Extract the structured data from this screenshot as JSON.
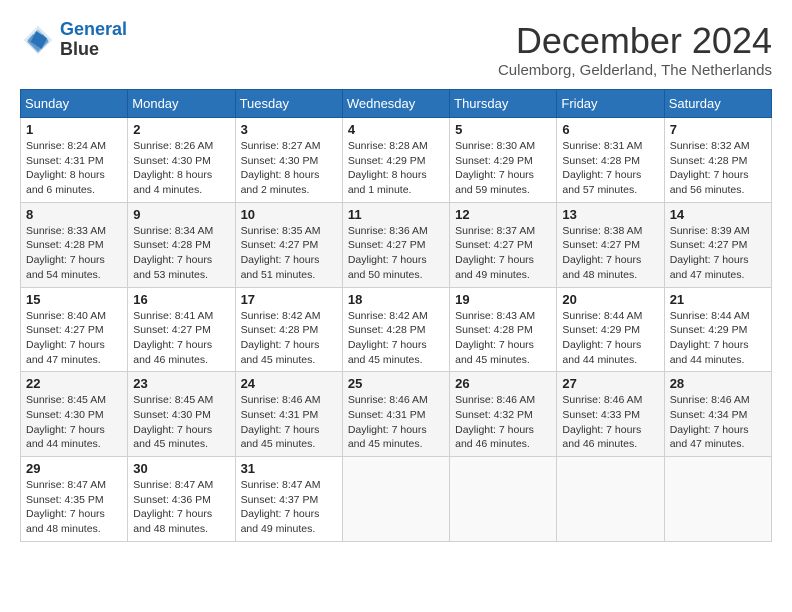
{
  "header": {
    "logo_line1": "General",
    "logo_line2": "Blue",
    "month_title": "December 2024",
    "subtitle": "Culemborg, Gelderland, The Netherlands"
  },
  "days_of_week": [
    "Sunday",
    "Monday",
    "Tuesday",
    "Wednesday",
    "Thursday",
    "Friday",
    "Saturday"
  ],
  "weeks": [
    [
      {
        "day": "1",
        "sunrise": "Sunrise: 8:24 AM",
        "sunset": "Sunset: 4:31 PM",
        "daylight": "Daylight: 8 hours and 6 minutes."
      },
      {
        "day": "2",
        "sunrise": "Sunrise: 8:26 AM",
        "sunset": "Sunset: 4:30 PM",
        "daylight": "Daylight: 8 hours and 4 minutes."
      },
      {
        "day": "3",
        "sunrise": "Sunrise: 8:27 AM",
        "sunset": "Sunset: 4:30 PM",
        "daylight": "Daylight: 8 hours and 2 minutes."
      },
      {
        "day": "4",
        "sunrise": "Sunrise: 8:28 AM",
        "sunset": "Sunset: 4:29 PM",
        "daylight": "Daylight: 8 hours and 1 minute."
      },
      {
        "day": "5",
        "sunrise": "Sunrise: 8:30 AM",
        "sunset": "Sunset: 4:29 PM",
        "daylight": "Daylight: 7 hours and 59 minutes."
      },
      {
        "day": "6",
        "sunrise": "Sunrise: 8:31 AM",
        "sunset": "Sunset: 4:28 PM",
        "daylight": "Daylight: 7 hours and 57 minutes."
      },
      {
        "day": "7",
        "sunrise": "Sunrise: 8:32 AM",
        "sunset": "Sunset: 4:28 PM",
        "daylight": "Daylight: 7 hours and 56 minutes."
      }
    ],
    [
      {
        "day": "8",
        "sunrise": "Sunrise: 8:33 AM",
        "sunset": "Sunset: 4:28 PM",
        "daylight": "Daylight: 7 hours and 54 minutes."
      },
      {
        "day": "9",
        "sunrise": "Sunrise: 8:34 AM",
        "sunset": "Sunset: 4:28 PM",
        "daylight": "Daylight: 7 hours and 53 minutes."
      },
      {
        "day": "10",
        "sunrise": "Sunrise: 8:35 AM",
        "sunset": "Sunset: 4:27 PM",
        "daylight": "Daylight: 7 hours and 51 minutes."
      },
      {
        "day": "11",
        "sunrise": "Sunrise: 8:36 AM",
        "sunset": "Sunset: 4:27 PM",
        "daylight": "Daylight: 7 hours and 50 minutes."
      },
      {
        "day": "12",
        "sunrise": "Sunrise: 8:37 AM",
        "sunset": "Sunset: 4:27 PM",
        "daylight": "Daylight: 7 hours and 49 minutes."
      },
      {
        "day": "13",
        "sunrise": "Sunrise: 8:38 AM",
        "sunset": "Sunset: 4:27 PM",
        "daylight": "Daylight: 7 hours and 48 minutes."
      },
      {
        "day": "14",
        "sunrise": "Sunrise: 8:39 AM",
        "sunset": "Sunset: 4:27 PM",
        "daylight": "Daylight: 7 hours and 47 minutes."
      }
    ],
    [
      {
        "day": "15",
        "sunrise": "Sunrise: 8:40 AM",
        "sunset": "Sunset: 4:27 PM",
        "daylight": "Daylight: 7 hours and 47 minutes."
      },
      {
        "day": "16",
        "sunrise": "Sunrise: 8:41 AM",
        "sunset": "Sunset: 4:27 PM",
        "daylight": "Daylight: 7 hours and 46 minutes."
      },
      {
        "day": "17",
        "sunrise": "Sunrise: 8:42 AM",
        "sunset": "Sunset: 4:28 PM",
        "daylight": "Daylight: 7 hours and 45 minutes."
      },
      {
        "day": "18",
        "sunrise": "Sunrise: 8:42 AM",
        "sunset": "Sunset: 4:28 PM",
        "daylight": "Daylight: 7 hours and 45 minutes."
      },
      {
        "day": "19",
        "sunrise": "Sunrise: 8:43 AM",
        "sunset": "Sunset: 4:28 PM",
        "daylight": "Daylight: 7 hours and 45 minutes."
      },
      {
        "day": "20",
        "sunrise": "Sunrise: 8:44 AM",
        "sunset": "Sunset: 4:29 PM",
        "daylight": "Daylight: 7 hours and 44 minutes."
      },
      {
        "day": "21",
        "sunrise": "Sunrise: 8:44 AM",
        "sunset": "Sunset: 4:29 PM",
        "daylight": "Daylight: 7 hours and 44 minutes."
      }
    ],
    [
      {
        "day": "22",
        "sunrise": "Sunrise: 8:45 AM",
        "sunset": "Sunset: 4:30 PM",
        "daylight": "Daylight: 7 hours and 44 minutes."
      },
      {
        "day": "23",
        "sunrise": "Sunrise: 8:45 AM",
        "sunset": "Sunset: 4:30 PM",
        "daylight": "Daylight: 7 hours and 45 minutes."
      },
      {
        "day": "24",
        "sunrise": "Sunrise: 8:46 AM",
        "sunset": "Sunset: 4:31 PM",
        "daylight": "Daylight: 7 hours and 45 minutes."
      },
      {
        "day": "25",
        "sunrise": "Sunrise: 8:46 AM",
        "sunset": "Sunset: 4:31 PM",
        "daylight": "Daylight: 7 hours and 45 minutes."
      },
      {
        "day": "26",
        "sunrise": "Sunrise: 8:46 AM",
        "sunset": "Sunset: 4:32 PM",
        "daylight": "Daylight: 7 hours and 46 minutes."
      },
      {
        "day": "27",
        "sunrise": "Sunrise: 8:46 AM",
        "sunset": "Sunset: 4:33 PM",
        "daylight": "Daylight: 7 hours and 46 minutes."
      },
      {
        "day": "28",
        "sunrise": "Sunrise: 8:46 AM",
        "sunset": "Sunset: 4:34 PM",
        "daylight": "Daylight: 7 hours and 47 minutes."
      }
    ],
    [
      {
        "day": "29",
        "sunrise": "Sunrise: 8:47 AM",
        "sunset": "Sunset: 4:35 PM",
        "daylight": "Daylight: 7 hours and 48 minutes."
      },
      {
        "day": "30",
        "sunrise": "Sunrise: 8:47 AM",
        "sunset": "Sunset: 4:36 PM",
        "daylight": "Daylight: 7 hours and 48 minutes."
      },
      {
        "day": "31",
        "sunrise": "Sunrise: 8:47 AM",
        "sunset": "Sunset: 4:37 PM",
        "daylight": "Daylight: 7 hours and 49 minutes."
      },
      null,
      null,
      null,
      null
    ]
  ]
}
